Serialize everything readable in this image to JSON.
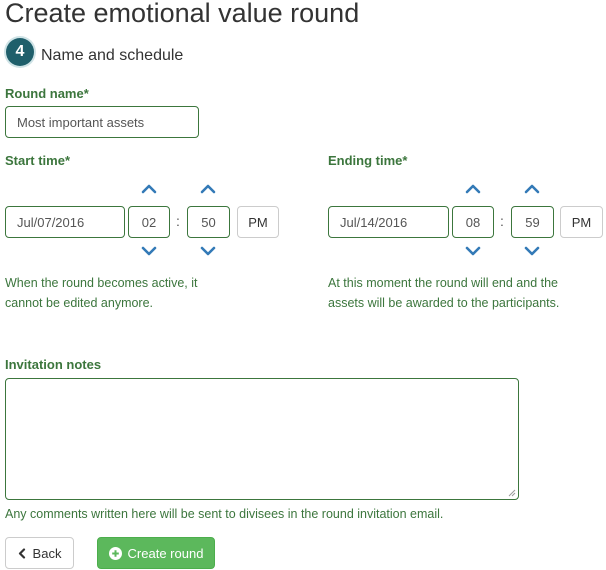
{
  "page": {
    "title": "Create emotional value round",
    "step_number": "4",
    "step_label": "Name and schedule"
  },
  "round_name": {
    "label": "Round name*",
    "value": "Most important assets"
  },
  "start_time": {
    "label": "Start time*",
    "date": "Jul/07/2016",
    "hour": "02",
    "minute": "50",
    "separator": ":",
    "meridian": "PM",
    "help": "When the round becomes active, it cannot be edited anymore."
  },
  "ending_time": {
    "label": "Ending time*",
    "date": "Jul/14/2016",
    "hour": "08",
    "minute": "59",
    "separator": ":",
    "meridian": "PM",
    "help": "At this moment the round will end and the assets will be awarded to the participants."
  },
  "invitation_notes": {
    "label": "Invitation notes",
    "value": "",
    "help": "Any comments written here will be sent to divisees in the round invitation email."
  },
  "actions": {
    "back_label": "Back",
    "create_label": "Create round"
  },
  "colors": {
    "success_green": "#3c763d",
    "button_green": "#5cb85c",
    "chevron_blue": "#337ab7",
    "step_badge": "#1f5f6b"
  },
  "icons": {
    "back": "chevron-left-icon",
    "create": "plus-circle-icon",
    "increment": "chevron-up-icon",
    "decrement": "chevron-down-icon"
  }
}
